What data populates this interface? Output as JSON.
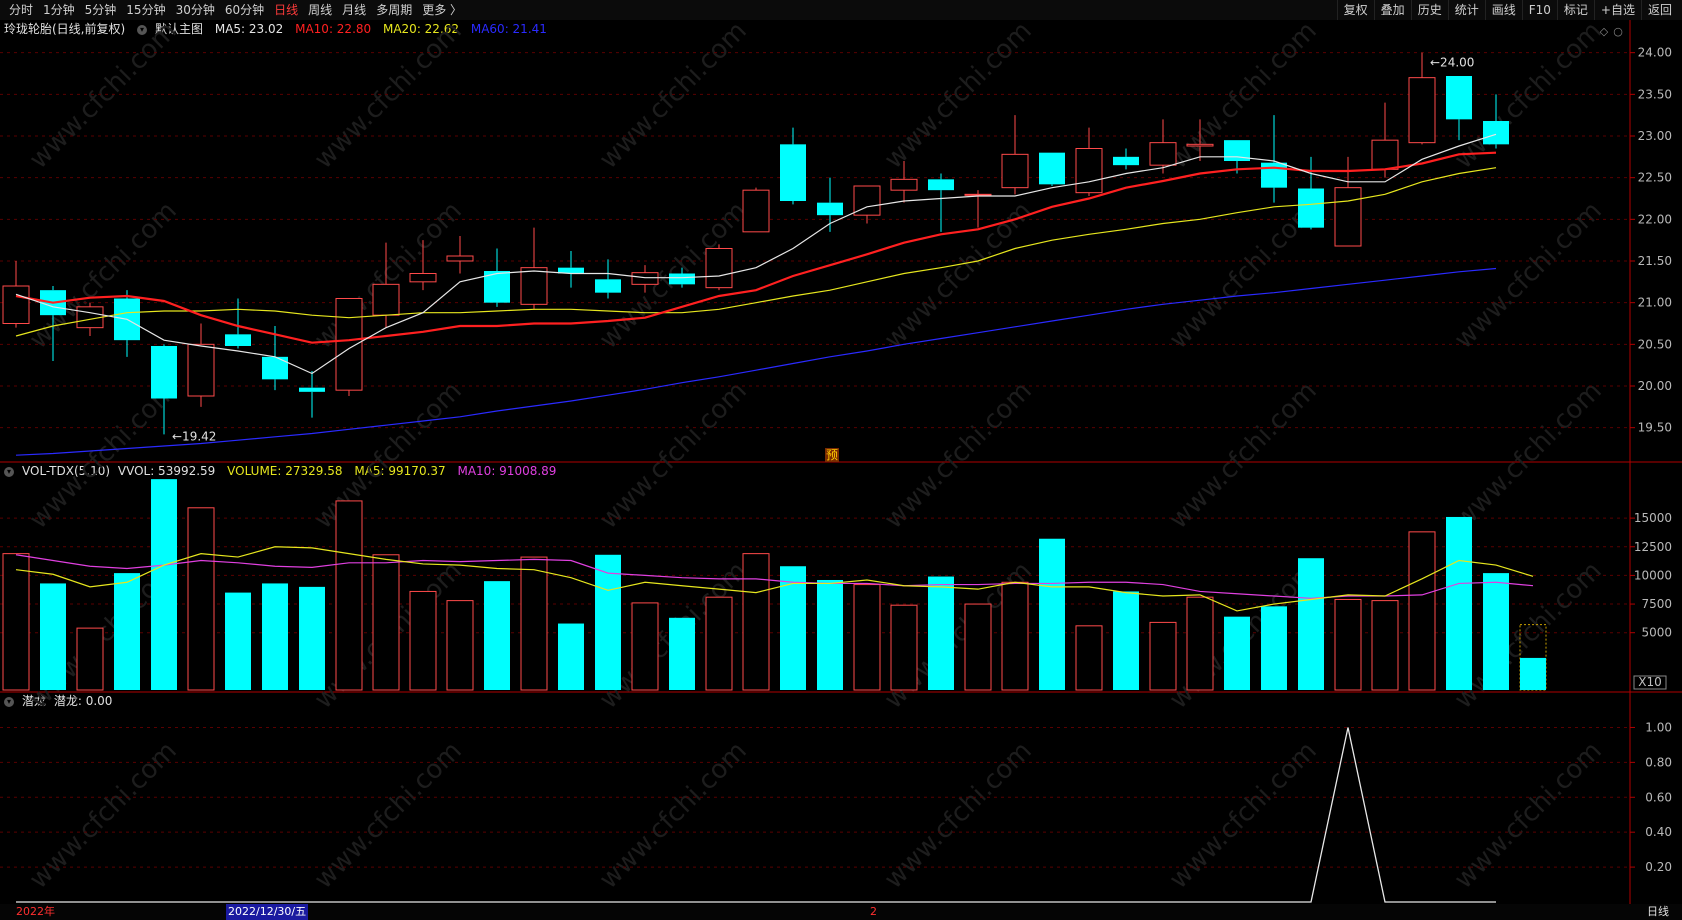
{
  "toolbar": {
    "periods": [
      "分时",
      "1分钟",
      "5分钟",
      "15分钟",
      "30分钟",
      "60分钟",
      "日线",
      "周线",
      "月线",
      "多周期",
      "更多 〉"
    ],
    "active_period": "日线",
    "right": [
      "复权",
      "叠加",
      "历史",
      "统计",
      "画线",
      "F10",
      "标记",
      "+自选",
      "返回"
    ]
  },
  "main_header": {
    "stock": "玲珑轮胎(日线,前复权)",
    "template": "默认主图",
    "ma5": "MA5: 23.02",
    "ma10": "MA10: 22.80",
    "ma20": "MA20: 22.62",
    "ma60": "MA60: 21.41"
  },
  "vol_header": {
    "name": "VOL-TDX(5,10)",
    "vvol": "VVOL: 53992.59",
    "volume": "VOLUME: 27329.58",
    "ma5": "MA5: 99170.37",
    "ma10": "MA10: 91008.89"
  },
  "ql_header": {
    "name": "潜龙",
    "value": "潜龙: 0.00"
  },
  "colors": {
    "up": "#ff4a4a",
    "down": "#00ffff",
    "ma5": "#e6e6e6",
    "ma10": "#ff2020",
    "ma20": "#e6e61e",
    "ma60": "#2a2aff",
    "vma5": "#e6e61e",
    "vma10": "#e040e0",
    "grid": "#5a0000",
    "axis": "#b00000"
  },
  "chart_data": [
    {
      "type": "candlestick",
      "title": "玲珑轮胎(日线,前复权)",
      "ylim": [
        19.1,
        24.2
      ],
      "yticks": [
        "24.00",
        "23.50",
        "23.00",
        "22.50",
        "22.00",
        "21.50",
        "21.00",
        "20.50",
        "20.00",
        "19.50"
      ],
      "annotations": [
        {
          "text": "24.00",
          "at": "high",
          "index": 38
        },
        {
          "text": "19.42",
          "at": "low",
          "index": 4
        }
      ],
      "marker": "预",
      "candles": [
        {
          "o": 20.75,
          "h": 21.5,
          "l": 20.7,
          "c": 21.2
        },
        {
          "o": 21.15,
          "h": 21.2,
          "l": 20.3,
          "c": 20.85
        },
        {
          "o": 20.7,
          "h": 21.0,
          "l": 20.6,
          "c": 20.95
        },
        {
          "o": 21.05,
          "h": 21.15,
          "l": 20.35,
          "c": 20.55
        },
        {
          "o": 20.48,
          "h": 20.5,
          "l": 19.42,
          "c": 19.85
        },
        {
          "o": 19.88,
          "h": 20.75,
          "l": 19.75,
          "c": 20.5
        },
        {
          "o": 20.62,
          "h": 21.05,
          "l": 20.45,
          "c": 20.48
        },
        {
          "o": 20.35,
          "h": 20.72,
          "l": 19.95,
          "c": 20.08
        },
        {
          "o": 19.98,
          "h": 20.18,
          "l": 19.62,
          "c": 19.93
        },
        {
          "o": 19.95,
          "h": 20.93,
          "l": 19.88,
          "c": 21.05
        },
        {
          "o": 20.85,
          "h": 21.72,
          "l": 20.7,
          "c": 21.22
        },
        {
          "o": 21.25,
          "h": 21.75,
          "l": 21.15,
          "c": 21.35
        },
        {
          "o": 21.5,
          "h": 21.8,
          "l": 21.35,
          "c": 21.56
        },
        {
          "o": 21.38,
          "h": 21.65,
          "l": 20.95,
          "c": 21.0
        },
        {
          "o": 20.98,
          "h": 21.9,
          "l": 20.92,
          "c": 21.42
        },
        {
          "o": 21.42,
          "h": 21.62,
          "l": 21.18,
          "c": 21.35
        },
        {
          "o": 21.28,
          "h": 21.52,
          "l": 21.05,
          "c": 21.12
        },
        {
          "o": 21.22,
          "h": 21.45,
          "l": 21.12,
          "c": 21.36
        },
        {
          "o": 21.35,
          "h": 21.42,
          "l": 21.18,
          "c": 21.22
        },
        {
          "o": 21.18,
          "h": 21.7,
          "l": 21.15,
          "c": 21.65
        },
        {
          "o": 21.85,
          "h": 22.38,
          "l": 21.85,
          "c": 22.35
        },
        {
          "o": 22.9,
          "h": 23.1,
          "l": 22.18,
          "c": 22.22
        },
        {
          "o": 22.2,
          "h": 22.5,
          "l": 21.85,
          "c": 22.05
        },
        {
          "o": 22.05,
          "h": 22.4,
          "l": 21.95,
          "c": 22.4
        },
        {
          "o": 22.35,
          "h": 22.7,
          "l": 22.2,
          "c": 22.48
        },
        {
          "o": 22.48,
          "h": 22.55,
          "l": 21.85,
          "c": 22.35
        },
        {
          "o": 22.3,
          "h": 22.35,
          "l": 21.9,
          "c": 22.3
        },
        {
          "o": 22.38,
          "h": 23.25,
          "l": 22.3,
          "c": 22.78
        },
        {
          "o": 22.8,
          "h": 22.8,
          "l": 22.4,
          "c": 22.42
        },
        {
          "o": 22.32,
          "h": 23.1,
          "l": 22.28,
          "c": 22.85
        },
        {
          "o": 22.75,
          "h": 22.85,
          "l": 22.6,
          "c": 22.65
        },
        {
          "o": 22.65,
          "h": 23.2,
          "l": 22.55,
          "c": 22.92
        },
        {
          "o": 22.88,
          "h": 23.2,
          "l": 22.7,
          "c": 22.9
        },
        {
          "o": 22.95,
          "h": 22.95,
          "l": 22.55,
          "c": 22.7
        },
        {
          "o": 22.68,
          "h": 23.25,
          "l": 22.2,
          "c": 22.38
        },
        {
          "o": 22.37,
          "h": 22.75,
          "l": 21.88,
          "c": 21.9
        },
        {
          "o": 21.68,
          "h": 22.75,
          "l": 21.68,
          "c": 22.38
        },
        {
          "o": 22.6,
          "h": 23.4,
          "l": 22.5,
          "c": 22.95
        },
        {
          "o": 22.92,
          "h": 24.0,
          "l": 22.9,
          "c": 23.7
        },
        {
          "o": 23.72,
          "h": 23.72,
          "l": 22.95,
          "c": 23.2
        },
        {
          "o": 23.18,
          "h": 23.5,
          "l": 22.85,
          "c": 22.9
        }
      ],
      "ma5": [
        21.1,
        20.95,
        20.88,
        20.8,
        20.55,
        20.48,
        20.42,
        20.35,
        20.15,
        20.45,
        20.7,
        20.88,
        21.25,
        21.35,
        21.38,
        21.35,
        21.35,
        21.3,
        21.3,
        21.32,
        21.42,
        21.65,
        21.95,
        22.15,
        22.22,
        22.25,
        22.28,
        22.28,
        22.38,
        22.45,
        22.55,
        22.62,
        22.75,
        22.75,
        22.7,
        22.55,
        22.45,
        22.45,
        22.72,
        22.88,
        23.02
      ],
      "ma10": [
        21.08,
        21.0,
        21.06,
        21.08,
        21.02,
        20.85,
        20.72,
        20.62,
        20.52,
        20.55,
        20.6,
        20.65,
        20.72,
        20.72,
        20.75,
        20.75,
        20.78,
        20.82,
        20.95,
        21.08,
        21.15,
        21.32,
        21.45,
        21.58,
        21.72,
        21.82,
        21.88,
        22.0,
        22.15,
        22.25,
        22.38,
        22.46,
        22.55,
        22.6,
        22.62,
        22.58,
        22.58,
        22.6,
        22.67,
        22.78,
        22.8
      ],
      "ma20": [
        20.6,
        20.72,
        20.8,
        20.88,
        20.9,
        20.9,
        20.92,
        20.9,
        20.85,
        20.82,
        20.85,
        20.88,
        20.88,
        20.9,
        20.92,
        20.92,
        20.9,
        20.88,
        20.88,
        20.92,
        21.0,
        21.08,
        21.15,
        21.25,
        21.35,
        21.42,
        21.5,
        21.65,
        21.75,
        21.82,
        21.88,
        21.95,
        22.0,
        22.08,
        22.15,
        22.18,
        22.22,
        22.3,
        22.45,
        22.55,
        22.62
      ],
      "ma60": [
        19.17,
        19.19,
        19.22,
        19.25,
        19.28,
        19.31,
        19.35,
        19.39,
        19.43,
        19.48,
        19.53,
        19.58,
        19.63,
        19.7,
        19.76,
        19.82,
        19.89,
        19.96,
        20.04,
        20.11,
        20.19,
        20.27,
        20.35,
        20.42,
        20.5,
        20.57,
        20.64,
        20.71,
        20.78,
        20.85,
        20.92,
        20.98,
        21.03,
        21.08,
        21.12,
        21.17,
        21.22,
        21.27,
        21.32,
        21.37,
        21.41
      ]
    },
    {
      "type": "bar",
      "title": "VOL-TDX(5,10)",
      "ylim": [
        0,
        18500
      ],
      "yticks": [
        "15000",
        "12500",
        "10000",
        "7500",
        "5000"
      ],
      "unit": "X10",
      "values": [
        11900,
        9300,
        5400,
        10200,
        18400,
        15900,
        8500,
        9300,
        9000,
        16500,
        11800,
        8600,
        7800,
        9500,
        11600,
        5800,
        11800,
        7600,
        6300,
        8100,
        11900,
        10800,
        9600,
        9200,
        7400,
        9900,
        7500,
        9400,
        13200,
        5600,
        8600,
        5900,
        8100,
        6400,
        7300,
        11500,
        7900,
        7800,
        13800,
        15100,
        10200,
        2800
      ],
      "vma5": [
        10500,
        10100,
        9000,
        9400,
        10900,
        11900,
        11600,
        12500,
        12400,
        11900,
        11400,
        11000,
        10900,
        10600,
        10500,
        9800,
        8700,
        9400,
        9100,
        8800,
        8500,
        9300,
        9300,
        9600,
        9100,
        9000,
        8800,
        9400,
        9000,
        9000,
        8500,
        8200,
        8300,
        6900,
        7500,
        7900,
        8300,
        8200,
        9700,
        11300,
        10900,
        9917
      ],
      "vma10": [
        11800,
        11300,
        10800,
        10600,
        10900,
        11300,
        11100,
        10800,
        10700,
        11100,
        11100,
        11300,
        11200,
        11300,
        11400,
        11300,
        10200,
        10000,
        9800,
        9700,
        9700,
        9400,
        9300,
        9300,
        9100,
        9200,
        9200,
        9300,
        9300,
        9400,
        9400,
        9200,
        8600,
        8400,
        8200,
        8000,
        8200,
        8200,
        8300,
        9300,
        9400,
        9101
      ]
    },
    {
      "type": "line",
      "title": "潜龙",
      "ylim": [
        0,
        1.1
      ],
      "yticks": [
        "1.00",
        "0.80",
        "0.60",
        "0.40",
        "0.20"
      ],
      "values": [
        0,
        0,
        0,
        0,
        0,
        0,
        0,
        0,
        0,
        0,
        0,
        0,
        0,
        0,
        0,
        0,
        0,
        0,
        0,
        0,
        0,
        0,
        0,
        0,
        0,
        0,
        0,
        0,
        0,
        0,
        0,
        0,
        0,
        0,
        0,
        0,
        1,
        0,
        0,
        0,
        0
      ]
    }
  ],
  "x_labels": {
    "year": "2022年",
    "cursor_date": "2022/12/30/五",
    "mid": "2",
    "period": "日线"
  },
  "watermark": "www.cfchi.com"
}
